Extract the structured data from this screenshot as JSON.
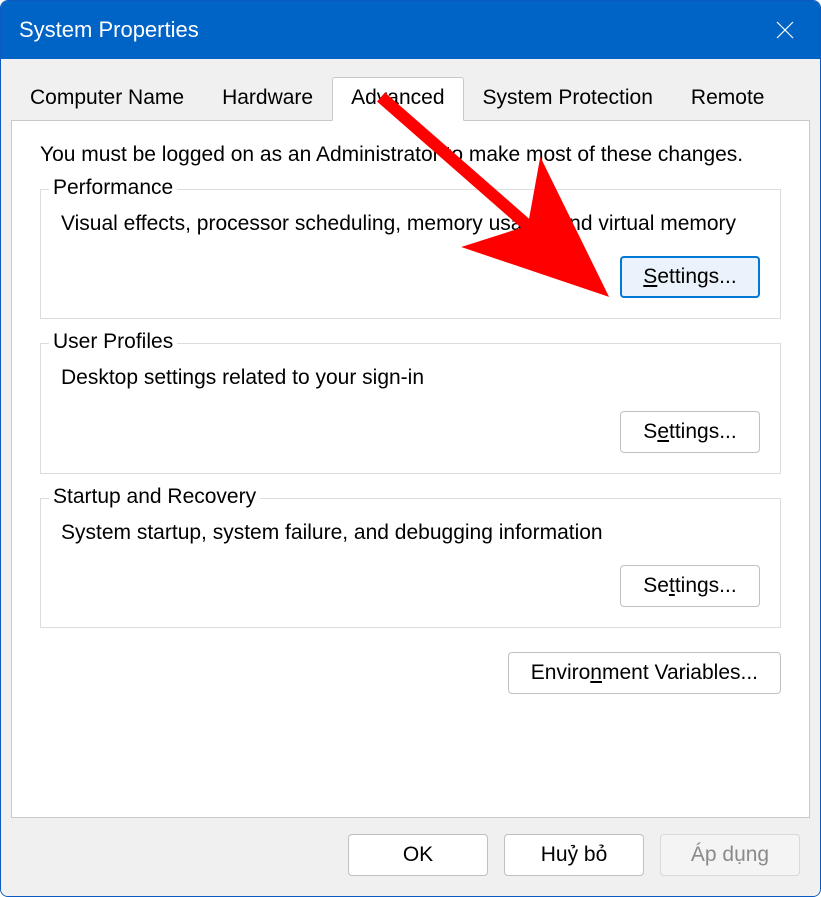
{
  "window": {
    "title": "System Properties"
  },
  "tabs": [
    {
      "label": "Computer Name",
      "active": false
    },
    {
      "label": "Hardware",
      "active": false
    },
    {
      "label": "Advanced",
      "active": true
    },
    {
      "label": "System Protection",
      "active": false
    },
    {
      "label": "Remote",
      "active": false
    }
  ],
  "panel": {
    "intro": "You must be logged on as an Administrator to make most of these changes.",
    "groups": {
      "performance": {
        "legend": "Performance",
        "desc": "Visual effects, processor scheduling, memory usage, and virtual memory",
        "button_prefix": "S",
        "button_rest": "ettings...",
        "focused": true
      },
      "userProfiles": {
        "legend": "User Profiles",
        "desc": "Desktop settings related to your sign-in",
        "button_prefix": "S",
        "button_mid": "e",
        "button_rest": "ttings...",
        "focused": false
      },
      "startupRecovery": {
        "legend": "Startup and Recovery",
        "desc": "System startup, system failure, and debugging information",
        "button_prefix": "Se",
        "button_mid": "t",
        "button_rest": "tings...",
        "focused": false
      }
    },
    "envButton_prefix": "Enviro",
    "envButton_mid": "n",
    "envButton_rest": "ment Variables..."
  },
  "footer": {
    "ok": "OK",
    "cancel": "Huỷ bỏ",
    "apply": "Áp dụng"
  },
  "annotation": {
    "arrow_color": "#ff0000"
  }
}
